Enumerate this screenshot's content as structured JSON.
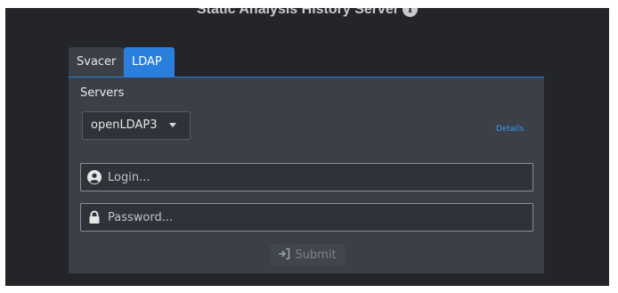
{
  "header": {
    "title": "Static Analysis History Server",
    "info_icon": "i"
  },
  "tabs": [
    {
      "label": "Svacer",
      "active": false
    },
    {
      "label": "LDAP",
      "active": true
    }
  ],
  "form": {
    "servers_label": "Servers",
    "server_select": {
      "value": "openLDAP3"
    },
    "details_link": "Details",
    "login": {
      "placeholder": "Login...",
      "value": "",
      "icon": "user-icon"
    },
    "password": {
      "placeholder": "Password...",
      "value": "",
      "icon": "lock-icon"
    },
    "submit_label": "Submit",
    "submit_icon": "sign-in-icon",
    "submit_enabled": false
  },
  "colors": {
    "background": "#232529",
    "panel": "#3b4048",
    "accent": "#2a7fde",
    "link": "#3b97f0"
  }
}
